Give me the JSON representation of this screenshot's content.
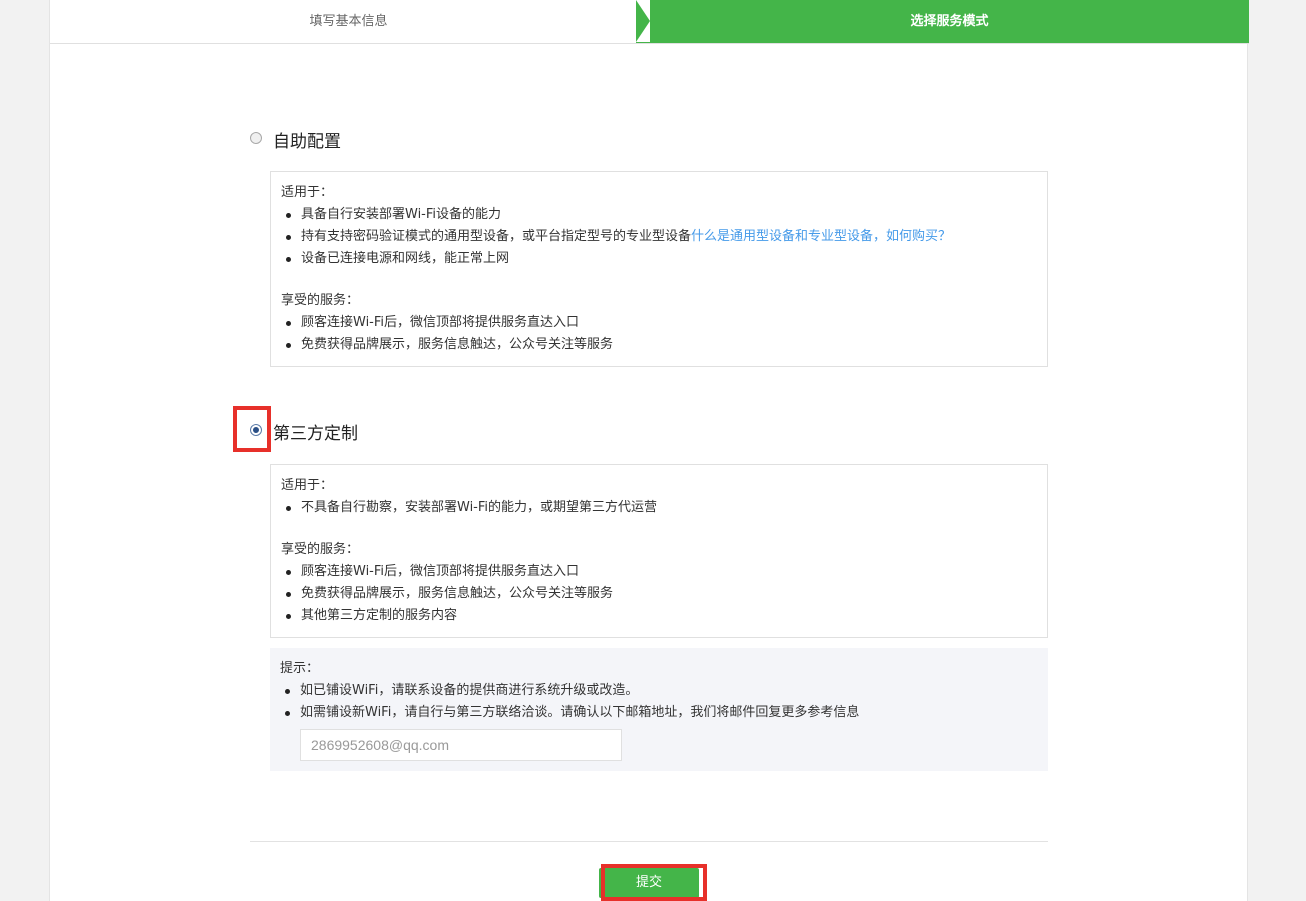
{
  "steps": [
    {
      "label": "填写基本信息",
      "active": false
    },
    {
      "label": "选择服务模式",
      "active": true
    }
  ],
  "colors": {
    "accent": "#44b549",
    "highlight": "#e7302a",
    "link": "#459ae9"
  },
  "option_self": {
    "label": "自助配置",
    "checked": false,
    "applies_heading": "适用于：",
    "applies_item_1": "具备自行安装部署Wi-Fi设备的能力",
    "applies_item_2_text": "持有支持密码验证模式的通用型设备，或平台指定型号的专业型设备",
    "applies_item_2_link": "什么是通用型设备和专业型设备，如何购买？",
    "applies_item_3": "设备已连接电源和网线，能正常上网",
    "services_heading": "享受的服务：",
    "service_1": "顾客连接Wi-Fi后，微信顶部将提供服务直达入口",
    "service_2": "免费获得品牌展示，服务信息触达，公众号关注等服务"
  },
  "option_third": {
    "label": "第三方定制",
    "checked": true,
    "applies_heading": "适用于：",
    "applies_item_1": "不具备自行勘察，安装部署Wi-Fi的能力，或期望第三方代运营",
    "services_heading": "享受的服务：",
    "service_1": "顾客连接Wi-Fi后，微信顶部将提供服务直达入口",
    "service_2": "免费获得品牌展示，服务信息触达，公众号关注等服务",
    "service_3": "其他第三方定制的服务内容"
  },
  "tip": {
    "heading": "提示：",
    "item_1": "如已铺设WiFi，请联系设备的提供商进行系统升级或改造。",
    "item_2": "如需铺设新WiFi，请自行与第三方联络洽谈。请确认以下邮箱地址，我们将邮件回复更多参考信息",
    "email_value": "2869952608@qq.com"
  },
  "submit_label": "提交"
}
